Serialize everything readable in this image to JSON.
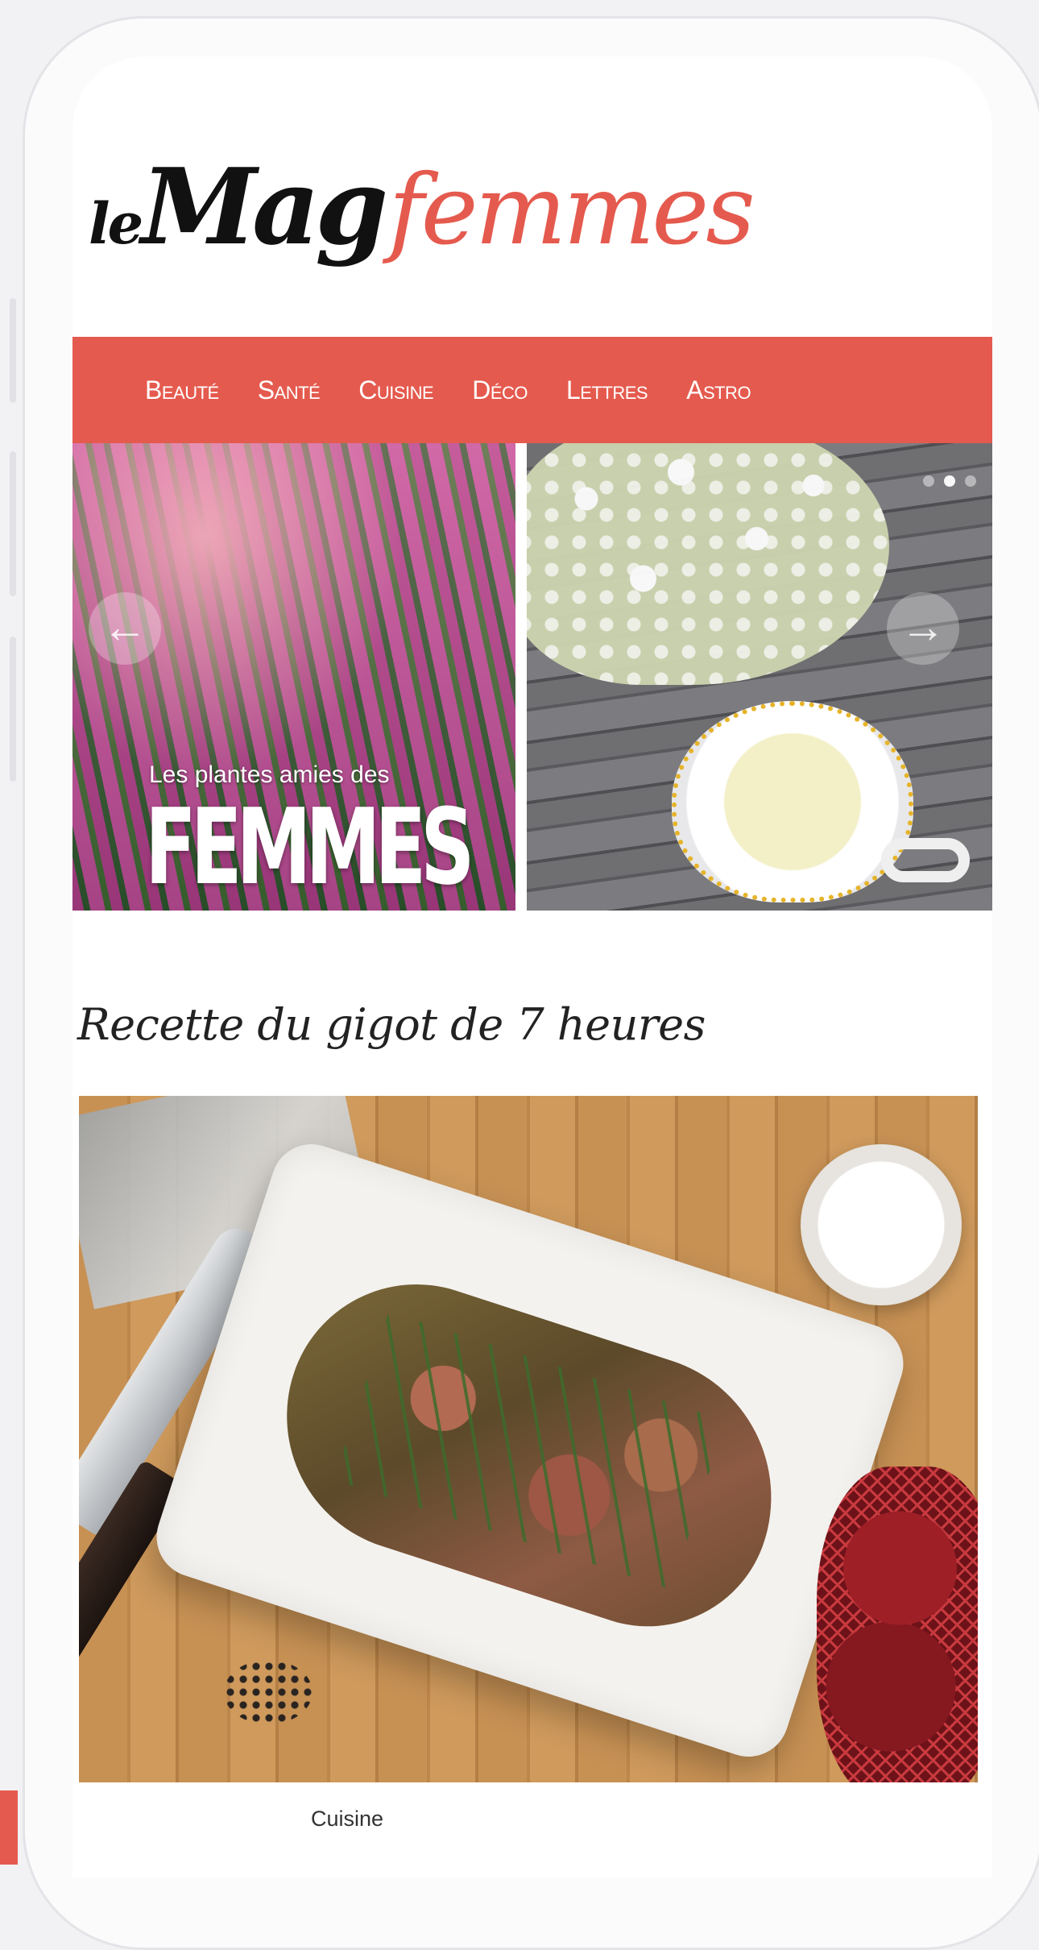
{
  "brand": {
    "logo_le": "le",
    "logo_mag": "Mag",
    "logo_femmes": "femmes",
    "accent_color": "#e55a4e"
  },
  "nav": {
    "items": [
      {
        "label": "Beauté"
      },
      {
        "label": "Santé"
      },
      {
        "label": "Cuisine"
      },
      {
        "label": "Déco"
      },
      {
        "label": "Lettres"
      },
      {
        "label": "Astro"
      }
    ]
  },
  "carousel": {
    "caption_small": "Les plantes amies des",
    "caption_big": "FEMMES",
    "prev_icon": "arrow-left-icon",
    "next_icon": "arrow-right-icon",
    "prev_glyph": "←",
    "next_glyph": "→",
    "slide_count": 3,
    "active_slide": 1
  },
  "article": {
    "title": "Recette du gigot de 7 heures",
    "category": "Cuisine"
  }
}
